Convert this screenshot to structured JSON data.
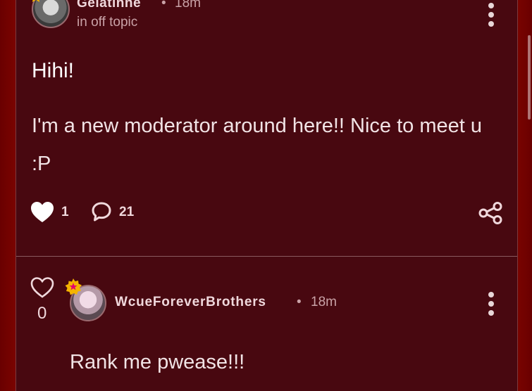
{
  "post1": {
    "author": "Gelatinne",
    "separator": "•",
    "time": "18m",
    "topic": "in off topic",
    "title": "Hihi!",
    "body": "I'm a new moderator around here!! Nice to meet u :P",
    "like_count": "1",
    "comment_count": "21"
  },
  "post2": {
    "vote_count": "0",
    "author": "WcueForeverBrothers",
    "separator": "•",
    "time": "18m",
    "text": "Rank me pwease!!!"
  },
  "icons": {
    "heart": "heart-icon",
    "heart_outline": "heart-outline-icon",
    "comment": "comment-icon",
    "share": "share-icon",
    "more": "kebab-menu-icon",
    "moderator_badge": "moderator-badge-icon",
    "star_badge": "star-badge-icon"
  },
  "colors": {
    "background": "#5e0000",
    "card": "#480810",
    "text": "#f1e3e5",
    "muted": "#c9a2a7",
    "badge_gold": "#f5b400",
    "badge_star": "#e5006e"
  }
}
